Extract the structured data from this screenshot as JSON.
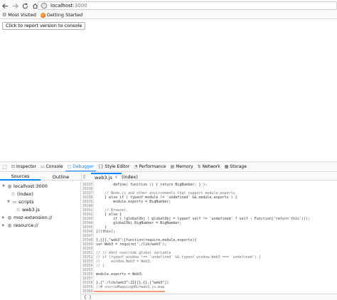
{
  "browser": {
    "url_host": "localhost",
    "url_port": ":3000",
    "bookmarks": [
      {
        "label": "Most Visited",
        "icon": "gear-icon"
      },
      {
        "label": "Getting Started",
        "icon": "firefox-icon"
      }
    ]
  },
  "page": {
    "report_button_label": "Click to report version to console"
  },
  "devtools": {
    "tabs": [
      {
        "label": "Inspector",
        "icon": "inspector-icon"
      },
      {
        "label": "Console",
        "icon": "console-icon"
      },
      {
        "label": "Debugger",
        "icon": "debugger-icon",
        "active": true
      },
      {
        "label": "Style Editor",
        "icon": "style-editor-icon"
      },
      {
        "label": "Performance",
        "icon": "performance-icon"
      },
      {
        "label": "Memory",
        "icon": "memory-icon"
      },
      {
        "label": "Network",
        "icon": "network-icon"
      },
      {
        "label": "Storage",
        "icon": "storage-icon"
      }
    ],
    "subtabs": {
      "sources": "Sources",
      "outline": "Outline"
    },
    "file_tabs": [
      {
        "label": "web3.js",
        "active": true
      },
      {
        "label": "(index)"
      }
    ],
    "tree": [
      {
        "label": "localhost:3000",
        "icon": "globe-icon",
        "expanded": true
      },
      {
        "label": "(index)",
        "icon": "file-icon"
      },
      {
        "label": "scripts",
        "icon": "folder-icon",
        "expanded": true
      },
      {
        "label": "web3.js",
        "icon": "js-file-icon"
      },
      {
        "label": "moz-extension://",
        "icon": "extension-icon",
        "expanded": false
      },
      {
        "label": "resource://",
        "icon": "globe-icon",
        "expanded": false
      }
    ],
    "code_lines": [
      {
        "n": "16335",
        "text": "        define( function () { return BigNumber; } );"
      },
      {
        "n": "16336",
        "text": ""
      },
      {
        "n": "16337",
        "text": "    // Node.js and other environments that support module.exports."
      },
      {
        "n": "16338",
        "text": "    } else if ( typeof module != 'undefined' && module.exports ) {"
      },
      {
        "n": "16339",
        "text": "        module.exports = BigNumber;"
      },
      {
        "n": "16340",
        "text": ""
      },
      {
        "n": "16341",
        "text": "    // Browser."
      },
      {
        "n": "16342",
        "text": "    } else {"
      },
      {
        "n": "16343",
        "text": "        if ( !globalObj ) globalObj = typeof self != 'undefined' ? self : Function('return this')();"
      },
      {
        "n": "16344",
        "text": "        globalObj.BigNumber = BigNumber;"
      },
      {
        "n": "16345",
        "text": "    }"
      },
      {
        "n": "16346",
        "text": "})(this);"
      },
      {
        "n": "16347",
        "text": ""
      },
      {
        "n": "16348",
        "text": "},{}],\"web3\":[function(require,module,exports){"
      },
      {
        "n": "16349",
        "text": "var Web3 = require('./lib/web3');"
      },
      {
        "n": "16350",
        "text": ""
      },
      {
        "n": "16351",
        "text": "// // dont override global variable"
      },
      {
        "n": "16352",
        "text": "// if (typeof window !== 'undefined' && typeof window.Web3 === 'undefined') {"
      },
      {
        "n": "16353",
        "text": "//     window.Web3 = Web3;"
      },
      {
        "n": "16354",
        "text": "// }"
      },
      {
        "n": "16355",
        "text": ""
      },
      {
        "n": "16356",
        "text": "module.exports = Web3;"
      },
      {
        "n": "16357",
        "text": ""
      },
      {
        "n": "16358",
        "text": "},{\"./lib/web3\":22}]},{},[\"web3\"])"
      },
      {
        "n": "16359",
        "text": "//# sourceMappingURL=web3.js.map"
      },
      {
        "n": "16360",
        "text": ""
      }
    ],
    "footer_text": "{ }"
  }
}
